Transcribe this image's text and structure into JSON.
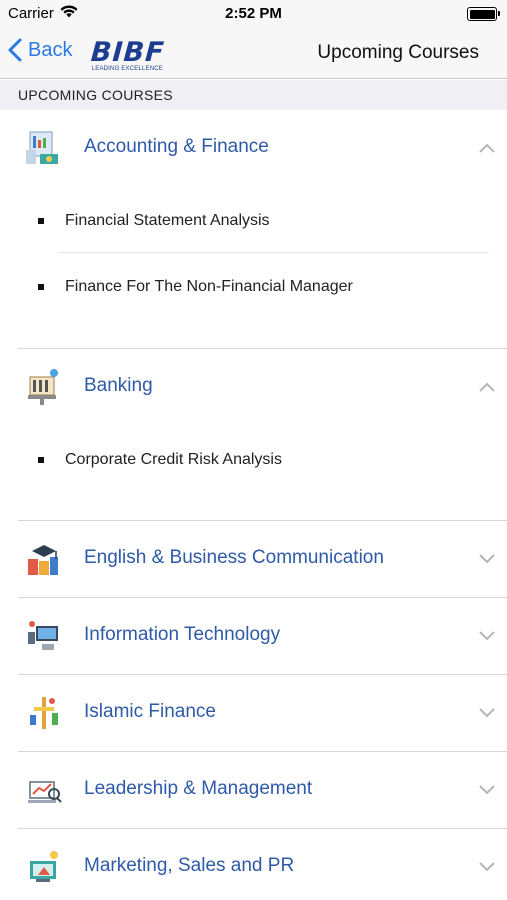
{
  "status_bar": {
    "carrier": "Carrier",
    "time": "2:52 PM"
  },
  "nav": {
    "back_label": "Back",
    "logo_text": "BIBF",
    "logo_tagline": "LEADING EXCELLENCE",
    "title": "Upcoming Courses"
  },
  "section": {
    "header": "UPCOMING COURSES"
  },
  "categories": [
    {
      "label": "Accounting & Finance",
      "icon": "accounting-icon",
      "expanded": true,
      "courses": [
        "Financial Statement Analysis",
        "Finance For The Non-Financial Manager"
      ]
    },
    {
      "label": "Banking",
      "icon": "banking-icon",
      "expanded": true,
      "courses": [
        "Corporate Credit Risk Analysis"
      ]
    },
    {
      "label": "English & Business Communication",
      "icon": "english-icon",
      "expanded": false
    },
    {
      "label": "Information Technology",
      "icon": "it-icon",
      "expanded": false
    },
    {
      "label": "Islamic Finance",
      "icon": "islamic-finance-icon",
      "expanded": false
    },
    {
      "label": "Leadership & Management",
      "icon": "leadership-icon",
      "expanded": false
    },
    {
      "label": "Marketing, Sales and PR",
      "icon": "marketing-icon",
      "expanded": false
    }
  ],
  "colors": {
    "accent": "#2a7ae2",
    "category_text": "#2e5aa8",
    "logo": "#1d3d91"
  }
}
